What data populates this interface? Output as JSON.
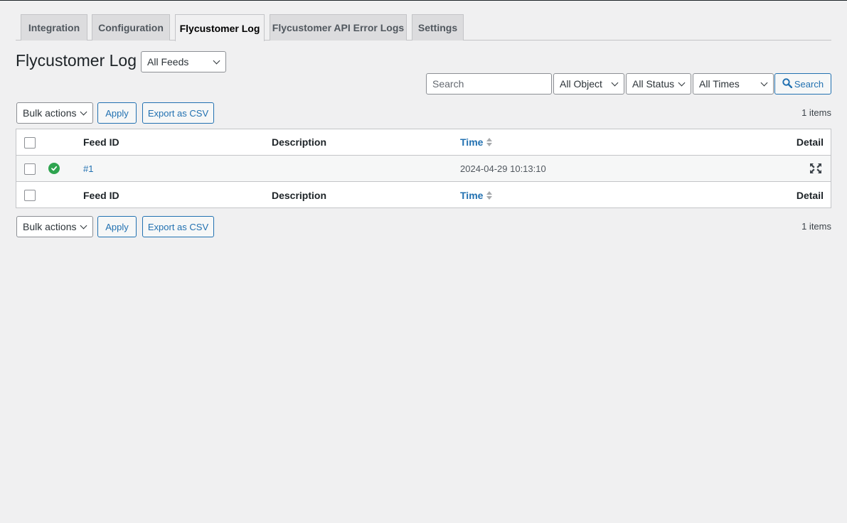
{
  "tabs": [
    {
      "label": "Integration",
      "active": false
    },
    {
      "label": "Configuration",
      "active": false
    },
    {
      "label": "Flycustomer Log",
      "active": true
    },
    {
      "label": "Flycustomer API Error Logs",
      "active": false
    },
    {
      "label": "Settings",
      "active": false
    }
  ],
  "page_title": "Flycustomer Log",
  "feed_filter": {
    "selected": "All Feeds"
  },
  "search": {
    "placeholder": "Search",
    "value": "",
    "button_label": "Search"
  },
  "filters": {
    "object": "All Object",
    "status": "All Status",
    "times": "All Times"
  },
  "top_nav": {
    "bulk_actions": "Bulk actions",
    "apply": "Apply",
    "export": "Export as CSV",
    "count": "1 items"
  },
  "bottom_nav": {
    "bulk_actions": "Bulk actions",
    "apply": "Apply",
    "export": "Export as CSV",
    "count": "1 items"
  },
  "table": {
    "columns": {
      "feed_id": "Feed ID",
      "description": "Description",
      "time": "Time",
      "detail": "Detail"
    },
    "rows": [
      {
        "status": "success",
        "feed_id": "#1",
        "description": "",
        "time": "2024-04-29 10:13:10"
      }
    ]
  },
  "colors": {
    "accent": "#2271b1",
    "success": "#2ea44f",
    "background": "#f0f0f1"
  }
}
